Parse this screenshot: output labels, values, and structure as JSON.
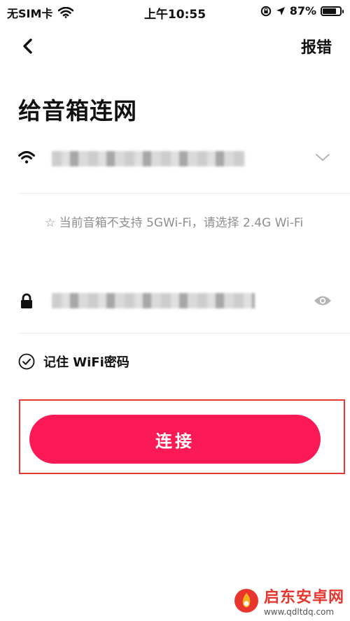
{
  "status_bar": {
    "carrier": "无SIM卡",
    "time": "上午10:55",
    "battery": "87%",
    "battery_level": 0.87
  },
  "nav": {
    "back_icon": "chevron-left-icon",
    "report_label": "报错"
  },
  "page_title": "给音箱连网",
  "wifi": {
    "icon": "wifi-icon",
    "network_name_redacted": true,
    "dropdown_icon": "chevron-down-icon"
  },
  "hint": "☆ 当前音箱不支持 5GWi-Fi，请选择 2.4G Wi-Fi",
  "password": {
    "icon": "lock-icon",
    "value_redacted": true,
    "visibility_icon": "eye-icon"
  },
  "remember": {
    "checked": true,
    "label": "记住 WiFi密码"
  },
  "connect_label": "连接",
  "colors": {
    "accent": "#fb1a56",
    "highlight_box": "#e53935",
    "hint_text": "#8f8f8f"
  },
  "watermark": {
    "name": "启东安卓网",
    "url": "www.qdltdq.com"
  }
}
